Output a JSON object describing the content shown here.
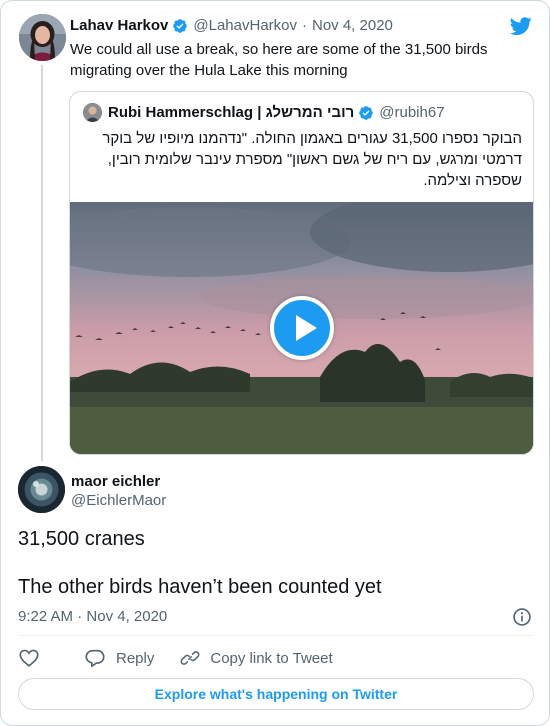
{
  "original_tweet": {
    "author_name": "Lahav Harkov",
    "handle": "@LahavHarkov",
    "separator": "·",
    "date": "Nov 4, 2020",
    "text": "We could all use a break, so here are some of the 31,500 birds migrating over the Hula Lake this morning"
  },
  "quoted_tweet": {
    "author_name": "Rubi Hammerschlag | רובי המרשלג",
    "handle": "@rubih67",
    "text": "הבוקר נספרו 31,500 עגורים באגמון החולה. \"נדהמנו מיופיו של בוקר דרמטי ומרגש, עם ריח של גשם ראשון\" מספרת עינבר שלומית רובין, שספרה וצילמה.",
    "media_type": "video"
  },
  "reply_tweet": {
    "author_name": "maor eichler",
    "handle": "@EichlerMaor",
    "line1": "31,500 cranes",
    "line2": "The other birds haven’t been counted yet",
    "time": "9:22 AM",
    "separator": "·",
    "date": "Nov 4, 2020"
  },
  "actions": {
    "reply_label": "Reply",
    "copy_link_label": "Copy link to Tweet"
  },
  "explore_label": "Explore what's happening on Twitter",
  "colors": {
    "accent": "#1d9bf0",
    "muted_text": "#536471",
    "border": "#cfd9de"
  },
  "icons": [
    "twitter-bird-icon",
    "verified-badge-icon",
    "play-icon",
    "info-icon",
    "heart-icon",
    "reply-icon",
    "link-icon"
  ]
}
